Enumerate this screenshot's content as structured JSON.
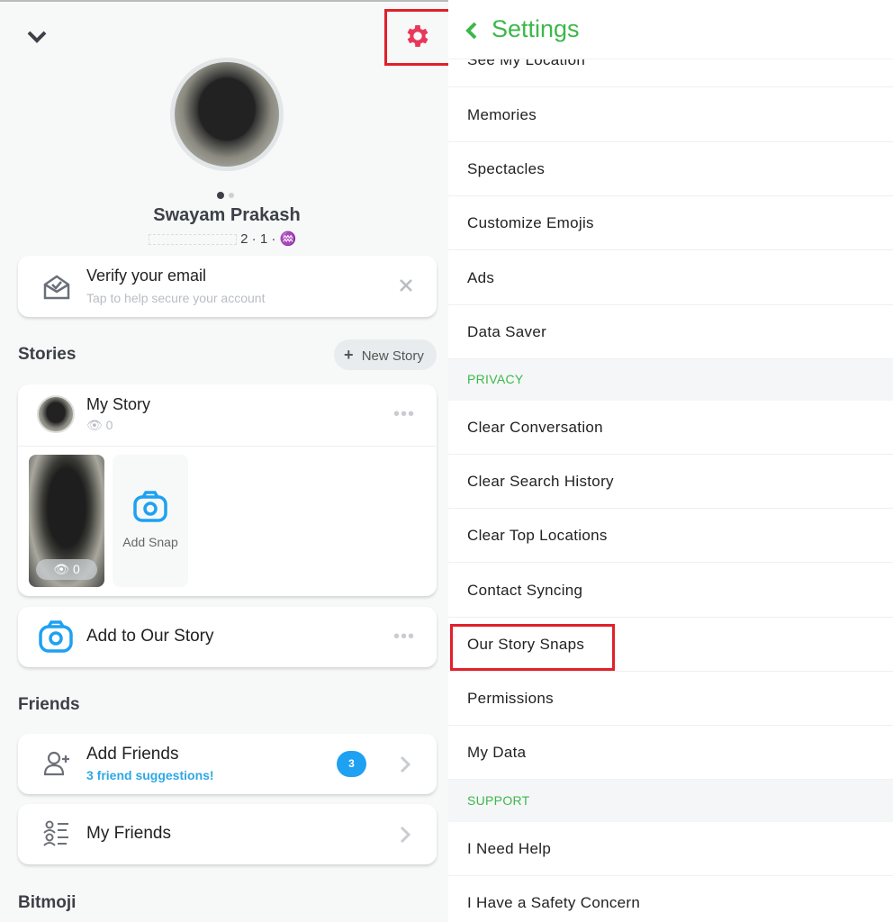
{
  "profile": {
    "name": "Swayam Prakash",
    "meta": "2 · 1 · ♒"
  },
  "verify": {
    "title": "Verify your email",
    "subtitle": "Tap to help secure your account"
  },
  "stories": {
    "title": "Stories",
    "new_story": "New Story",
    "my_story": "My Story",
    "my_story_views": "0",
    "snap_views": "0",
    "add_snap": "Add Snap",
    "add_our_story": "Add to Our Story"
  },
  "friends": {
    "title": "Friends",
    "add_friends": "Add Friends",
    "suggestions": "3 friend suggestions!",
    "badge": "3",
    "my_friends": "My Friends"
  },
  "bitmoji": {
    "title": "Bitmoji"
  },
  "settings": {
    "title": "Settings",
    "partial_item": "See My Location",
    "items_a": [
      "Memories",
      "Spectacles",
      "Customize Emojis",
      "Ads",
      "Data Saver"
    ],
    "privacy_header": "PRIVACY",
    "items_b": [
      "Clear Conversation",
      "Clear Search History",
      "Clear Top Locations",
      "Contact Syncing",
      "Our Story Snaps",
      "Permissions",
      "My Data"
    ],
    "support_header": "SUPPORT",
    "items_c": [
      "I Need Help",
      "I Have a Safety Concern"
    ]
  },
  "colors": {
    "accent_green": "#3cb84a",
    "gear_red": "#e8385a",
    "highlight_red": "#e0202a",
    "blue": "#1ea1f2"
  }
}
